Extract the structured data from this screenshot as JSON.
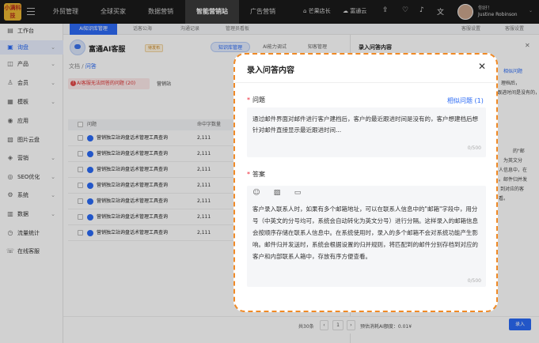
{
  "topbar": {
    "logo_text": "小满科技",
    "nav": [
      "外贸管理",
      "全球买家",
      "数据营销",
      "智能营销站",
      "广告营销"
    ],
    "active_nav_index": 3,
    "store": "芒果店长",
    "tong": "富通云",
    "user_greeting": "你好！",
    "user_name": "Justine Robinson"
  },
  "sidebar": {
    "items": [
      {
        "label": "工作台",
        "icon": "workbench-icon"
      },
      {
        "label": "询盘",
        "icon": "inquiry-icon"
      },
      {
        "label": "产品",
        "icon": "product-icon"
      },
      {
        "label": "会员",
        "icon": "member-icon"
      },
      {
        "label": "模板",
        "icon": "template-icon"
      },
      {
        "label": "应用",
        "icon": "app-icon"
      },
      {
        "label": "图片云盘",
        "icon": "image-cloud-icon"
      },
      {
        "label": "营销",
        "icon": "marketing-icon"
      },
      {
        "label": "SEO优化",
        "icon": "seo-icon"
      },
      {
        "label": "系统",
        "icon": "system-icon"
      },
      {
        "label": "数据",
        "icon": "data-icon"
      },
      {
        "label": "流量统计",
        "icon": "traffic-icon"
      },
      {
        "label": "在线客服",
        "icon": "online-service-icon"
      }
    ],
    "active_index": 1
  },
  "tabs": [
    "AI知识库管理",
    "话客公海",
    "沟通记录",
    "管理员看板",
    "",
    "",
    "客服设置",
    "客服设置"
  ],
  "header": {
    "app_title": "富通AI客服",
    "badge": "待发布",
    "pills": [
      "知识库管理",
      "AI能力调试",
      "知客管理"
    ]
  },
  "breadcrumb": {
    "root": "文档",
    "current": "问答"
  },
  "alert": "AI客服无法回答的问题 (20)",
  "category": "营销站",
  "table": {
    "headers": [
      "问题",
      "命中字数量"
    ],
    "rows": [
      {
        "q": "营销独立站询盘话术管理工具查询",
        "v": "2,111"
      },
      {
        "q": "营销独立站询盘话术管理工具查询",
        "v": "2,111"
      },
      {
        "q": "营销独立站询盘话术管理工具查询",
        "v": "2,111"
      },
      {
        "q": "营销独立站询盘话术管理工具查询",
        "v": "2,111"
      },
      {
        "q": "营销独立站询盘话术管理工具查询",
        "v": "2,111"
      },
      {
        "q": "营销独立站询盘话术管理工具查询",
        "v": "2,111"
      },
      {
        "q": "营销独立站询盘话术管理工具查询",
        "v": "2,111"
      }
    ]
  },
  "right_panel": {
    "title": "录入问答内容",
    "link": "相似问题",
    "lines_top": [
      "理档后，",
      "跟进时间是没有的，"
    ],
    "lines_bottom": [
      "的\"邮",
      "为英文分",
      "人信息中，在",
      "。邮件归并发",
      "到对应的客",
      "看。"
    ]
  },
  "footer": {
    "total": "共30条",
    "page": "1",
    "remaining": "预估消耗AI额度：0.01¥",
    "add_button": "录入"
  },
  "modal": {
    "title": "录入问答内容",
    "question_label": "问题",
    "similar_link": "相似问题 (1)",
    "question_text": "通过邮件界面对邮件进行客户建档后，客户的最近跟进时间是没有的，客户想建档后想针对邮件直接显示最近跟进时间...",
    "question_count": "0/500",
    "answer_label": "答案",
    "answer_text": "客户录入联系人时，如果有多个邮箱地址，可以在联系人信息中的\"邮箱\"字段中，用分号（中英文的分号均可，系统会自动转化为英文分号）进行分隔。这样录入的邮箱信息会按顺序存储在联系人信息中。在系统使用时，录入的多个邮箱不会对系统功能产生影响。邮件归并发送时，系统会根据设置的归并规则，将匹配到的邮件分别存档到对应的客户和内部联系人箱中，存放有序方便查看。",
    "answer_count": "0/500",
    "tools": [
      "emoji-icon",
      "image-icon",
      "file-icon"
    ]
  }
}
